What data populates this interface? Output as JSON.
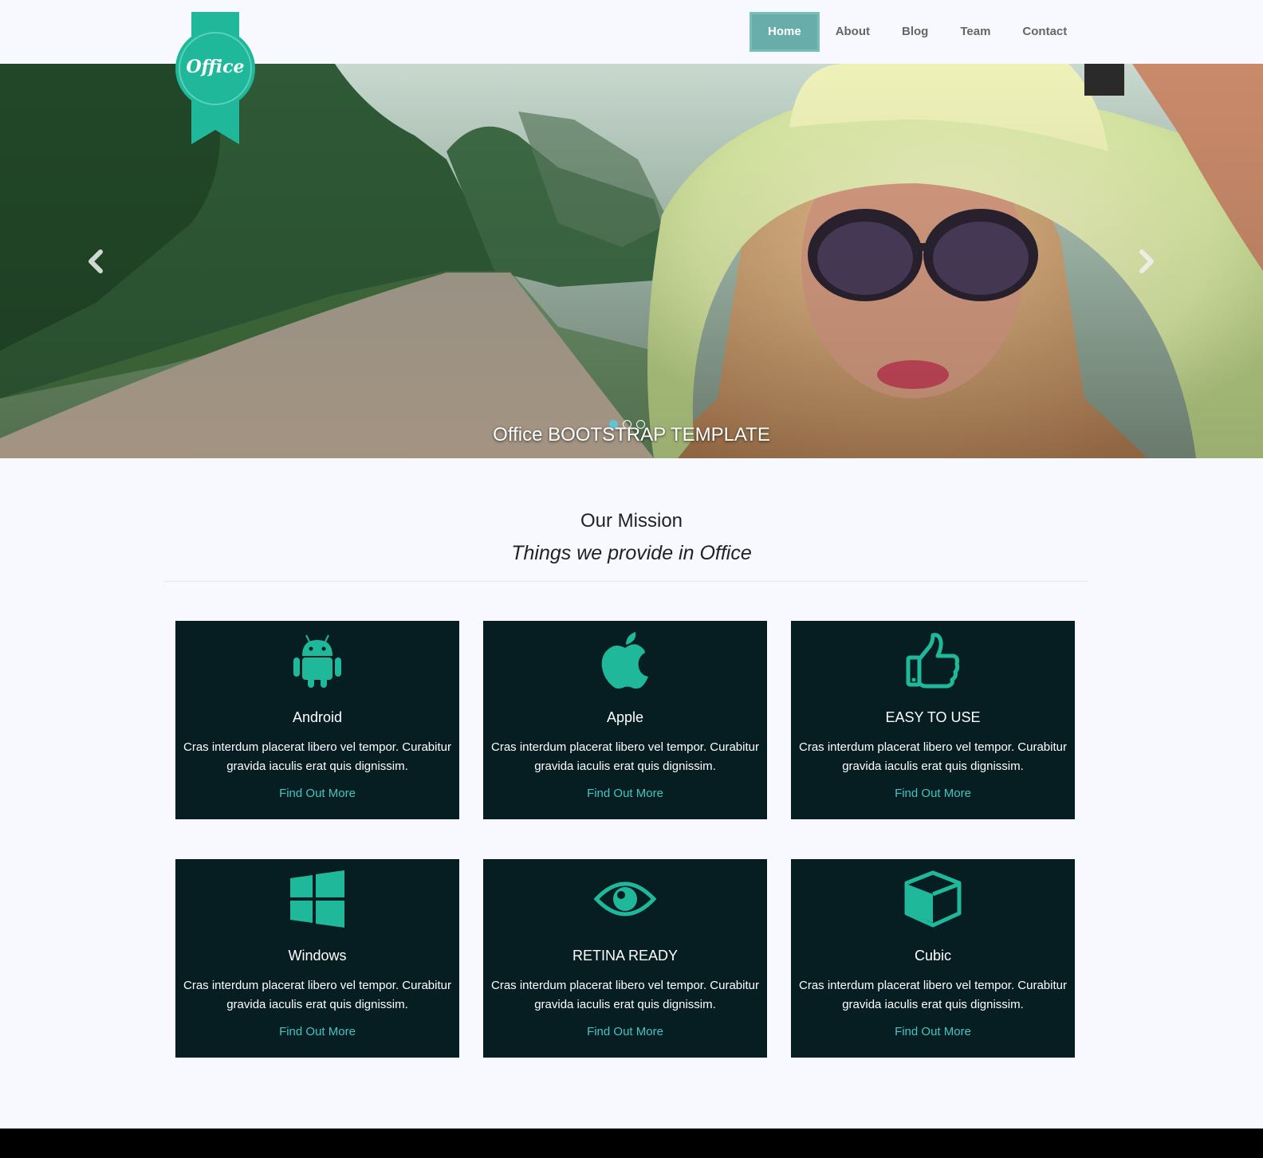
{
  "logo": {
    "text": "Office"
  },
  "nav": {
    "items": [
      {
        "label": "Home",
        "active": true
      },
      {
        "label": "About"
      },
      {
        "label": "Blog"
      },
      {
        "label": "Team"
      },
      {
        "label": "Contact"
      }
    ]
  },
  "hero": {
    "caption": "Office BOOTSTRAP TEMPLATE",
    "slide_count": 3,
    "active_slide": 1
  },
  "mission": {
    "title": "Our Mission",
    "subtitle": "Things we provide in Office"
  },
  "features": [
    {
      "icon": "android-icon",
      "title": "Android",
      "text": "Cras interdum placerat libero vel tempor. Curabitur gravida iaculis erat quis dignissim.",
      "link": "Find Out More"
    },
    {
      "icon": "apple-icon",
      "title": "Apple",
      "text": "Cras interdum placerat libero vel tempor. Curabitur gravida iaculis erat quis dignissim.",
      "link": "Find Out More"
    },
    {
      "icon": "thumbs-up-icon",
      "title": "EASY TO USE",
      "text": "Cras interdum placerat libero vel tempor. Curabitur gravida iaculis erat quis dignissim.",
      "link": "Find Out More"
    },
    {
      "icon": "windows-icon",
      "title": "Windows",
      "text": "Cras interdum placerat libero vel tempor. Curabitur gravida iaculis erat quis dignissim.",
      "link": "Find Out More"
    },
    {
      "icon": "eye-icon",
      "title": "RETINA READY",
      "text": "Cras interdum placerat libero vel tempor. Curabitur gravida iaculis erat quis dignissim.",
      "link": "Find Out More"
    },
    {
      "icon": "cube-icon",
      "title": "Cubic",
      "text": "Cras interdum placerat libero vel tempor. Curabitur gravida iaculis erat quis dignissim.",
      "link": "Find Out More"
    }
  ],
  "colors": {
    "accent": "#1abc9c",
    "nav_active": "#68ada9",
    "card_bg": "#061e21",
    "link": "#45c4c0",
    "page_bg": "#f7f9fe"
  }
}
